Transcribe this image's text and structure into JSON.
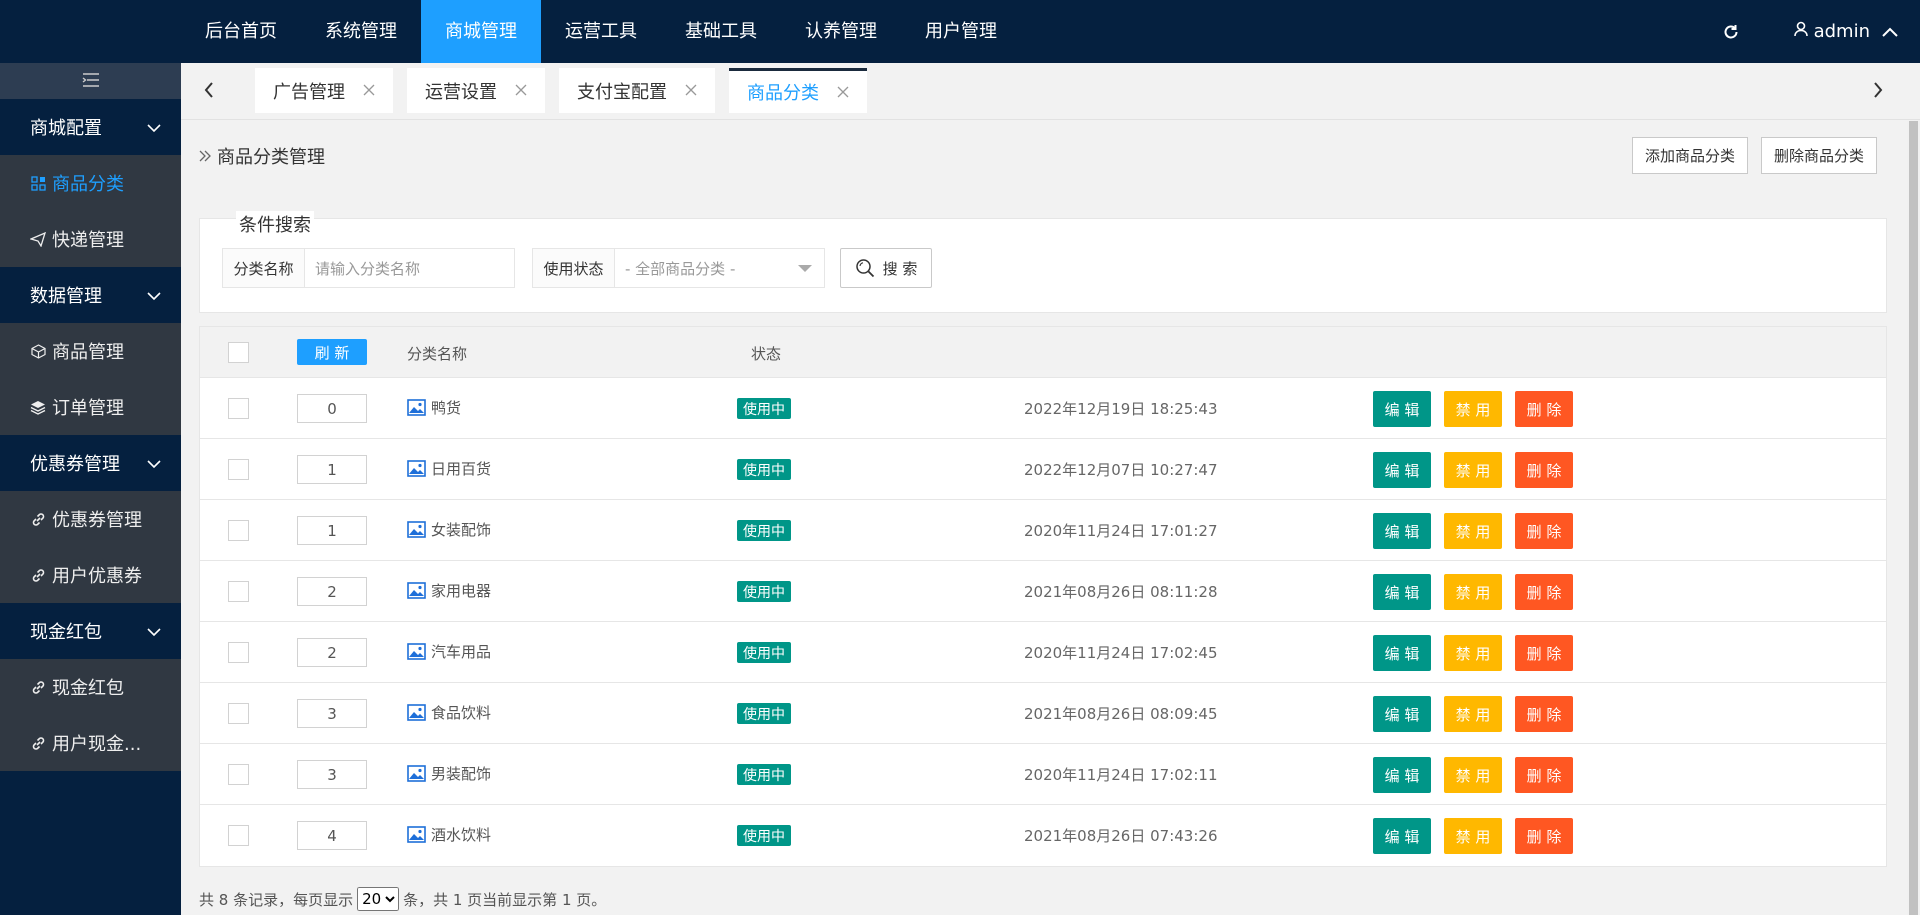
{
  "top_nav": {
    "items": [
      "后台首页",
      "系统管理",
      "商城管理",
      "运营工具",
      "基础工具",
      "认养管理",
      "用户管理"
    ],
    "active_index": 2,
    "username": "admin"
  },
  "sidebar": {
    "groups": [
      {
        "label": "商城配置",
        "items": [
          {
            "label": "商品分类",
            "icon": "grid-icon",
            "active": true
          },
          {
            "label": "快递管理",
            "icon": "send-icon"
          }
        ]
      },
      {
        "label": "数据管理",
        "items": [
          {
            "label": "商品管理",
            "icon": "box-icon"
          },
          {
            "label": "订单管理",
            "icon": "layers-icon"
          }
        ]
      },
      {
        "label": "优惠券管理",
        "items": [
          {
            "label": "优惠券管理",
            "icon": "link-icon"
          },
          {
            "label": "用户优惠券",
            "icon": "link-icon"
          }
        ]
      },
      {
        "label": "现金红包",
        "items": [
          {
            "label": "现金红包",
            "icon": "link-icon"
          },
          {
            "label": "用户现金...",
            "icon": "link-icon"
          }
        ]
      }
    ]
  },
  "tabs": [
    {
      "label": "广告管理",
      "active": false
    },
    {
      "label": "运营设置",
      "active": false
    },
    {
      "label": "支付宝配置",
      "active": false
    },
    {
      "label": "商品分类",
      "active": true
    }
  ],
  "page": {
    "breadcrumb": "商品分类管理",
    "add_button": "添加商品分类",
    "delete_button": "删除商品分类"
  },
  "search": {
    "title": "条件搜索",
    "name_label": "分类名称",
    "name_placeholder": "请输入分类名称",
    "status_label": "使用状态",
    "status_value": "- 全部商品分类 -",
    "button": "搜 索"
  },
  "table": {
    "refresh_label": "刷 新",
    "col_name": "分类名称",
    "col_status": "状态",
    "edit_label": "编 辑",
    "ban_label": "禁 用",
    "delete_label": "删 除",
    "rows": [
      {
        "sort": "0",
        "name": "鸭货",
        "status": "使用中",
        "time": "2022年12月19日 18:25:43"
      },
      {
        "sort": "1",
        "name": "日用百货",
        "status": "使用中",
        "time": "2022年12月07日 10:27:47"
      },
      {
        "sort": "1",
        "name": "女装配饰",
        "status": "使用中",
        "time": "2020年11月24日 17:01:27"
      },
      {
        "sort": "2",
        "name": "家用电器",
        "status": "使用中",
        "time": "2021年08月26日 08:11:28"
      },
      {
        "sort": "2",
        "name": "汽车用品",
        "status": "使用中",
        "time": "2020年11月24日 17:02:45"
      },
      {
        "sort": "3",
        "name": "食品饮料",
        "status": "使用中",
        "time": "2021年08月26日 08:09:45"
      },
      {
        "sort": "3",
        "name": "男装配饰",
        "status": "使用中",
        "time": "2020年11月24日 17:02:11"
      },
      {
        "sort": "4",
        "name": "酒水饮料",
        "status": "使用中",
        "time": "2021年08月26日 07:43:26"
      }
    ]
  },
  "pager": {
    "prefix": "共 8 条记录，每页显示",
    "page_size": "20",
    "suffix": "条，共 1 页当前显示第 1 页。"
  },
  "colors": {
    "nav_bg": "#05203f",
    "accent": "#1e9fff",
    "green": "#009688",
    "yellow": "#ffb800",
    "red": "#ff5722"
  }
}
